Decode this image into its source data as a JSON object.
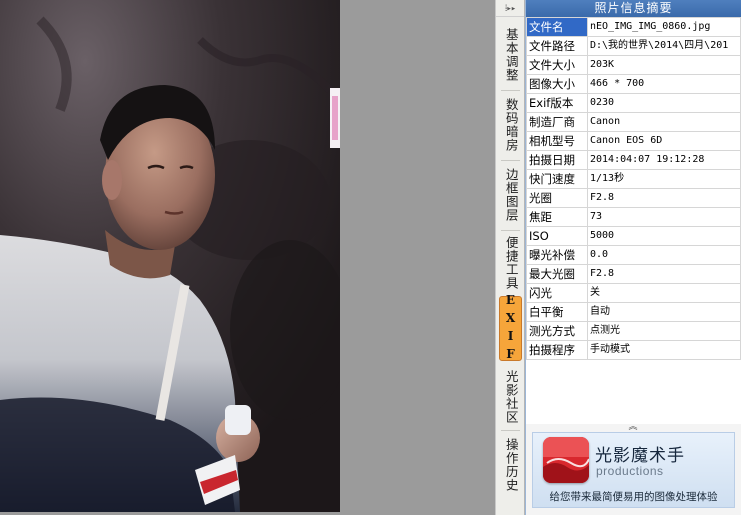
{
  "tabstrip": {
    "top_glyph": "⁞▸▸",
    "tabs": [
      {
        "label": "基本调整",
        "active": false
      },
      {
        "label": "数码暗房",
        "active": false
      },
      {
        "label": "边框图层",
        "active": false
      },
      {
        "label": "便捷工具",
        "active": false
      },
      {
        "label": "EXIF",
        "active": true
      },
      {
        "label": "光影社区",
        "active": false
      },
      {
        "label": "操作历史",
        "active": false
      }
    ]
  },
  "panel": {
    "title": "照片信息摘要",
    "rows": [
      {
        "key": "文件名",
        "value": "nEO_IMG_IMG_0860.jpg",
        "selected": true
      },
      {
        "key": "文件路径",
        "value": "D:\\我的世界\\2014\\四月\\201",
        "selected": false
      },
      {
        "key": "文件大小",
        "value": "203K",
        "selected": false
      },
      {
        "key": "图像大小",
        "value": "466 * 700",
        "selected": false
      },
      {
        "key": "Exif版本",
        "value": "0230",
        "selected": false
      },
      {
        "key": "制造厂商",
        "value": "Canon",
        "selected": false
      },
      {
        "key": "相机型号",
        "value": "Canon EOS 6D",
        "selected": false
      },
      {
        "key": "拍摄日期",
        "value": "2014:04:07 19:12:28",
        "selected": false
      },
      {
        "key": "快门速度",
        "value": "1/13秒",
        "selected": false
      },
      {
        "key": "光圈",
        "value": "F2.8",
        "selected": false
      },
      {
        "key": "焦距",
        "value": "73",
        "selected": false
      },
      {
        "key": "ISO",
        "value": "5000",
        "selected": false
      },
      {
        "key": "曝光补偿",
        "value": "0.0",
        "selected": false
      },
      {
        "key": "最大光圈",
        "value": "F2.8",
        "selected": false
      },
      {
        "key": "闪光",
        "value": "关",
        "selected": false
      },
      {
        "key": "白平衡",
        "value": "自动",
        "selected": false
      },
      {
        "key": "测光方式",
        "value": "点测光",
        "selected": false
      },
      {
        "key": "拍摄程序",
        "value": "手动模式",
        "selected": false
      }
    ],
    "collapse_glyph": "︽",
    "ad": {
      "title": "光影魔术手",
      "subtitle": "productions",
      "slogan": "给您带来最简便易用的图像处理体验"
    }
  },
  "colors": {
    "panel_title_bg": "#3f6fb0",
    "selected_key_bg": "#3169c6",
    "active_tab_bg": "#f6a53a",
    "canvas_bg": "#9b9b9b"
  }
}
